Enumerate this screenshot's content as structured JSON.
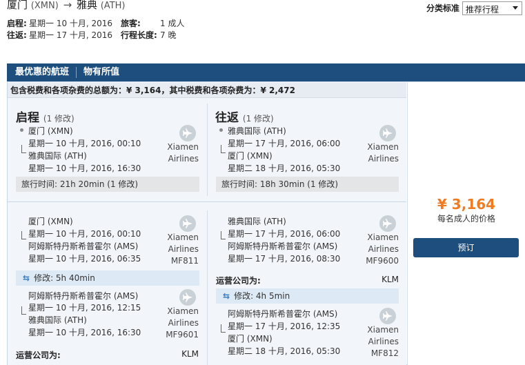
{
  "header": {
    "from_city": "厦门",
    "from_code": "(XMN)",
    "to_city": "雅典",
    "to_code": "(ATH)",
    "depart_label": "启程:",
    "depart_value": "星期一 10 十月, 2016",
    "return_label": "往返:",
    "return_value": "星期一 17 十月, 2016",
    "traveler_label": "旅客:",
    "traveler_value": "1 成人",
    "length_label": "行程长度:",
    "length_value": "7 晚"
  },
  "sort": {
    "label": "分类标准",
    "value": "推荐行程"
  },
  "tabs": [
    "最优惠的航班",
    "物有所值"
  ],
  "summary": "包含税费和各项杂费的总额为：¥ 3,164，其中税费和各项杂费为：¥ 2,472",
  "outbound": {
    "title": "启程",
    "sub": "(1 修改)",
    "from": "厦门 (XMN)",
    "dep_time": "星期一 10 十月, 2016, 00:10",
    "to": "雅典国际 (ATH)",
    "arr_time": "星期一 10 十月, 2016, 16:30",
    "airline": [
      "Xiamen",
      "Airlines"
    ],
    "duration": "旅行时间: 21h 20min (1 修改)",
    "seg1": {
      "from": "厦门 (XMN)",
      "dep": "星期一 10 十月, 2016, 00:10",
      "to": "阿姆斯特丹斯希普霍尔 (AMS)",
      "arr": "星期一 10 十月, 2016, 06:35",
      "airline": [
        "Xiamen",
        "Airlines"
      ],
      "flight": "MF811"
    },
    "layover": "修改: 5h 40min",
    "seg2": {
      "from": "阿姆斯特丹斯希普霍尔 (AMS)",
      "dep": "星期一 10 十月, 2016, 12:15",
      "to": "雅典国际 (ATH)",
      "arr": "星期一 10 十月, 2016, 16:30",
      "airline": [
        "Xiamen",
        "Airlines"
      ],
      "flight": "MF9601"
    },
    "operator_label": "运营公司为:",
    "operator": "KLM"
  },
  "inbound": {
    "title": "往返",
    "sub": "(1 修改)",
    "from": "雅典国际 (ATH)",
    "dep_time": "星期一 17 十月, 2016, 06:00",
    "to": "厦门 (XMN)",
    "arr_time": "星期二 18 十月, 2016, 05:30",
    "airline": [
      "Xiamen",
      "Airlines"
    ],
    "duration": "旅行时间: 18h 30min (1 修改)",
    "seg1": {
      "from": "雅典国际 (ATH)",
      "dep": "星期一 17 十月, 2016, 06:00",
      "to": "阿姆斯特丹斯希普霍尔 (AMS)",
      "arr": "星期一 17 十月, 2016, 08:30",
      "airline": [
        "Xiamen",
        "Airlines"
      ],
      "flight": "MF9600"
    },
    "operator_label": "运营公司为:",
    "operator": "KLM",
    "layover": "修改: 4h 5min",
    "seg2": {
      "from": "阿姆斯特丹斯希普霍尔 (AMS)",
      "dep": "星期一 17 十月, 2016, 12:35",
      "to": "厦门 (XMN)",
      "arr": "星期二 18 十月, 2016, 05:30",
      "airline": [
        "Xiamen",
        "Airlines"
      ],
      "flight": "MF812"
    }
  },
  "price": {
    "amount": "¥ 3,164",
    "note": "每名成人的价格",
    "book_label": "预订"
  }
}
